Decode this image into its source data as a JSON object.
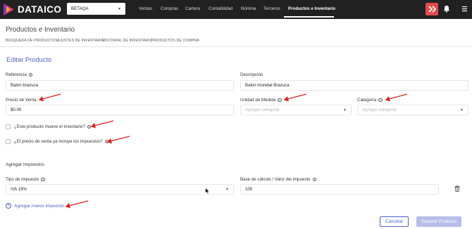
{
  "navbar": {
    "brand": "DATAICO",
    "company": "BETAQA",
    "items": [
      "Ventas",
      "Compras",
      "Cartera",
      "Contabilidad",
      "Nómina",
      "Terceros",
      "Productos e Inventario"
    ],
    "active_index": 6,
    "colors": {
      "background": "#212121",
      "help_button": "#e64a4a"
    }
  },
  "page": {
    "title": "Productos e Inventario",
    "subnav": [
      "BÚSQUEDA DE PRODUCTOS",
      "AJUSTES DE INVENTARIO",
      "HISTORIAL DE INVENTARIO",
      "PRODUCTOS DE COMPRA"
    ]
  },
  "form": {
    "section_title": "Editar Producto",
    "referencia": {
      "label": "Referencia",
      "value": "Balon brazuca"
    },
    "descripcion": {
      "label": "Descripción",
      "value": "Balon mundial Brazuca"
    },
    "precio": {
      "label": "Precio de Venta",
      "value": "$0.00"
    },
    "unidad": {
      "label": "Unidad de Medida",
      "placeholder": "Agregar categoria"
    },
    "categoria": {
      "label": "Categoría",
      "placeholder": "Agregar categoria"
    },
    "check_inventory": {
      "label": "¿Este producto mueve el inventario?",
      "checked": false
    },
    "check_taxes": {
      "label": "¿El precio de venta ya incluye los impuestos?",
      "checked": false
    }
  },
  "taxes": {
    "title": "Agregar Impuestos",
    "tipo": {
      "label": "Tipo de impuesto",
      "value": "IVA 19%"
    },
    "base": {
      "label": "Base de cálculo / Valor del impuesto",
      "value": "100"
    },
    "add_label": "Agregar nuevo impuesto"
  },
  "actions": {
    "cancel": "Cancelar",
    "save": "Guardar Producto"
  },
  "accent_color": "#5060c8",
  "annotation_color": "#e02020"
}
